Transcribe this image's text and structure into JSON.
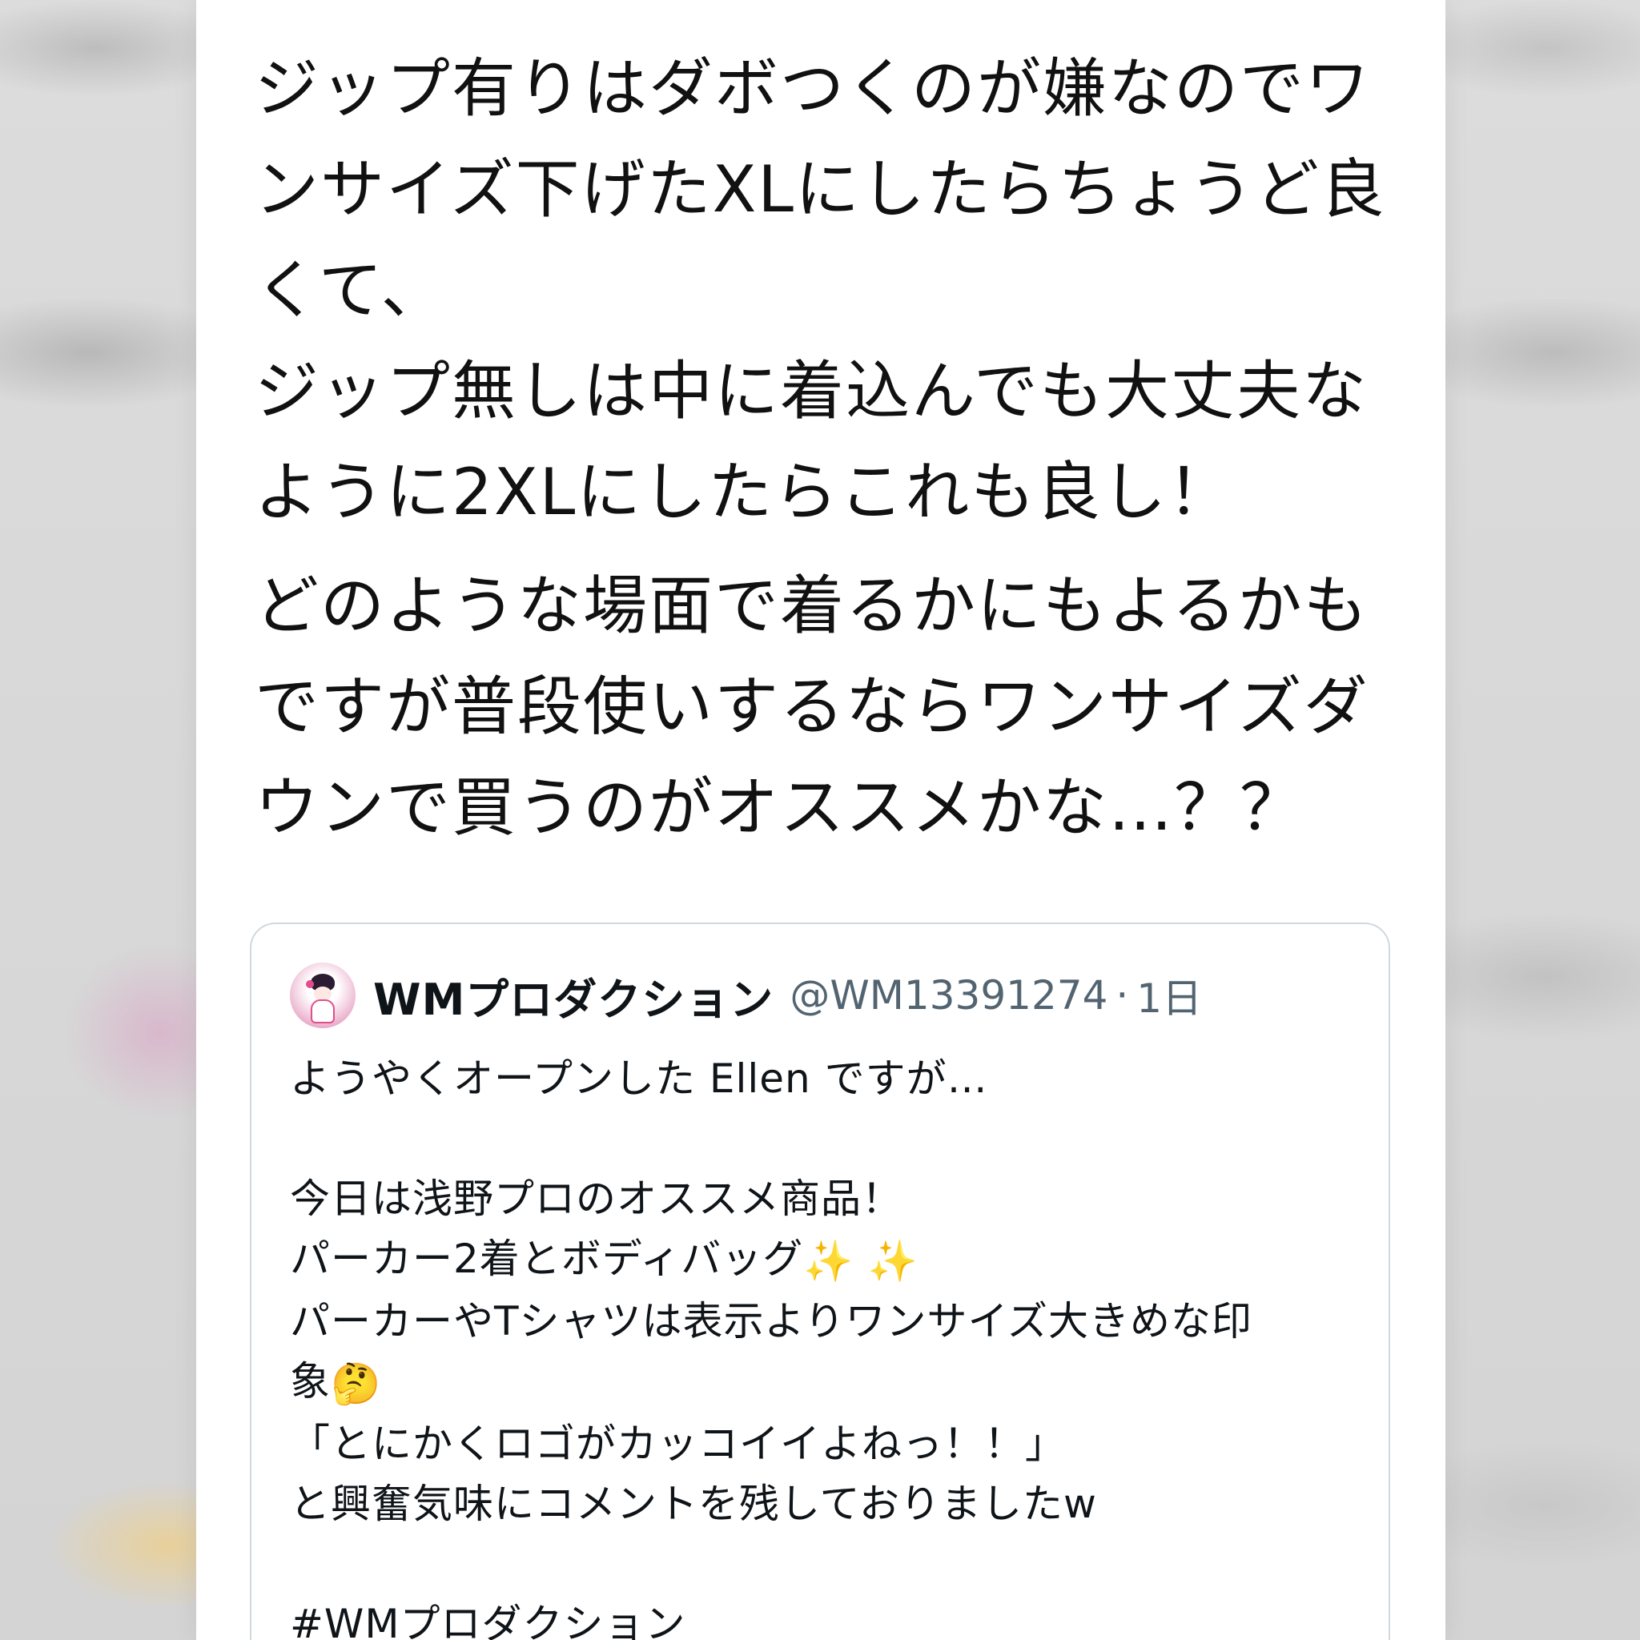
{
  "tweet": {
    "paragraphs": [
      "ジップ有りはダボつくのが嫌なのでワンサイズ下げたXLにしたらちょうど良くて、\nジップ無しは中に着込んでも大丈夫なように2XLにしたらこれも良し！",
      "どのような場面で着るかにもよるかもですが普段使いするならワンサイズダウンで買うのがオススメかな…？？"
    ]
  },
  "quoted_tweet": {
    "display_name": "WMプロダクション",
    "handle": "@WM13391274",
    "separator": "·",
    "time": "1日",
    "lines": [
      "ようやくオープンした Ellen ですが…",
      "",
      "今日は浅野プロのオススメ商品！",
      "パーカー2着とボディバッグ",
      "パーカーやTシャツは表示よりワンサイズ大きめな印",
      "象",
      "「とにかくロゴがカッコイイよねっ！！」",
      "と興奮気味にコメントを残しておりましたw",
      "",
      "#WMプロダクション"
    ],
    "emojis": {
      "sparkles": "✨ ✨",
      "thinking": "🤔"
    }
  },
  "colors": {
    "text_primary": "#0f1419",
    "text_secondary": "#536471",
    "border": "#cfd9de",
    "accent_pink": "#e24d8a"
  }
}
